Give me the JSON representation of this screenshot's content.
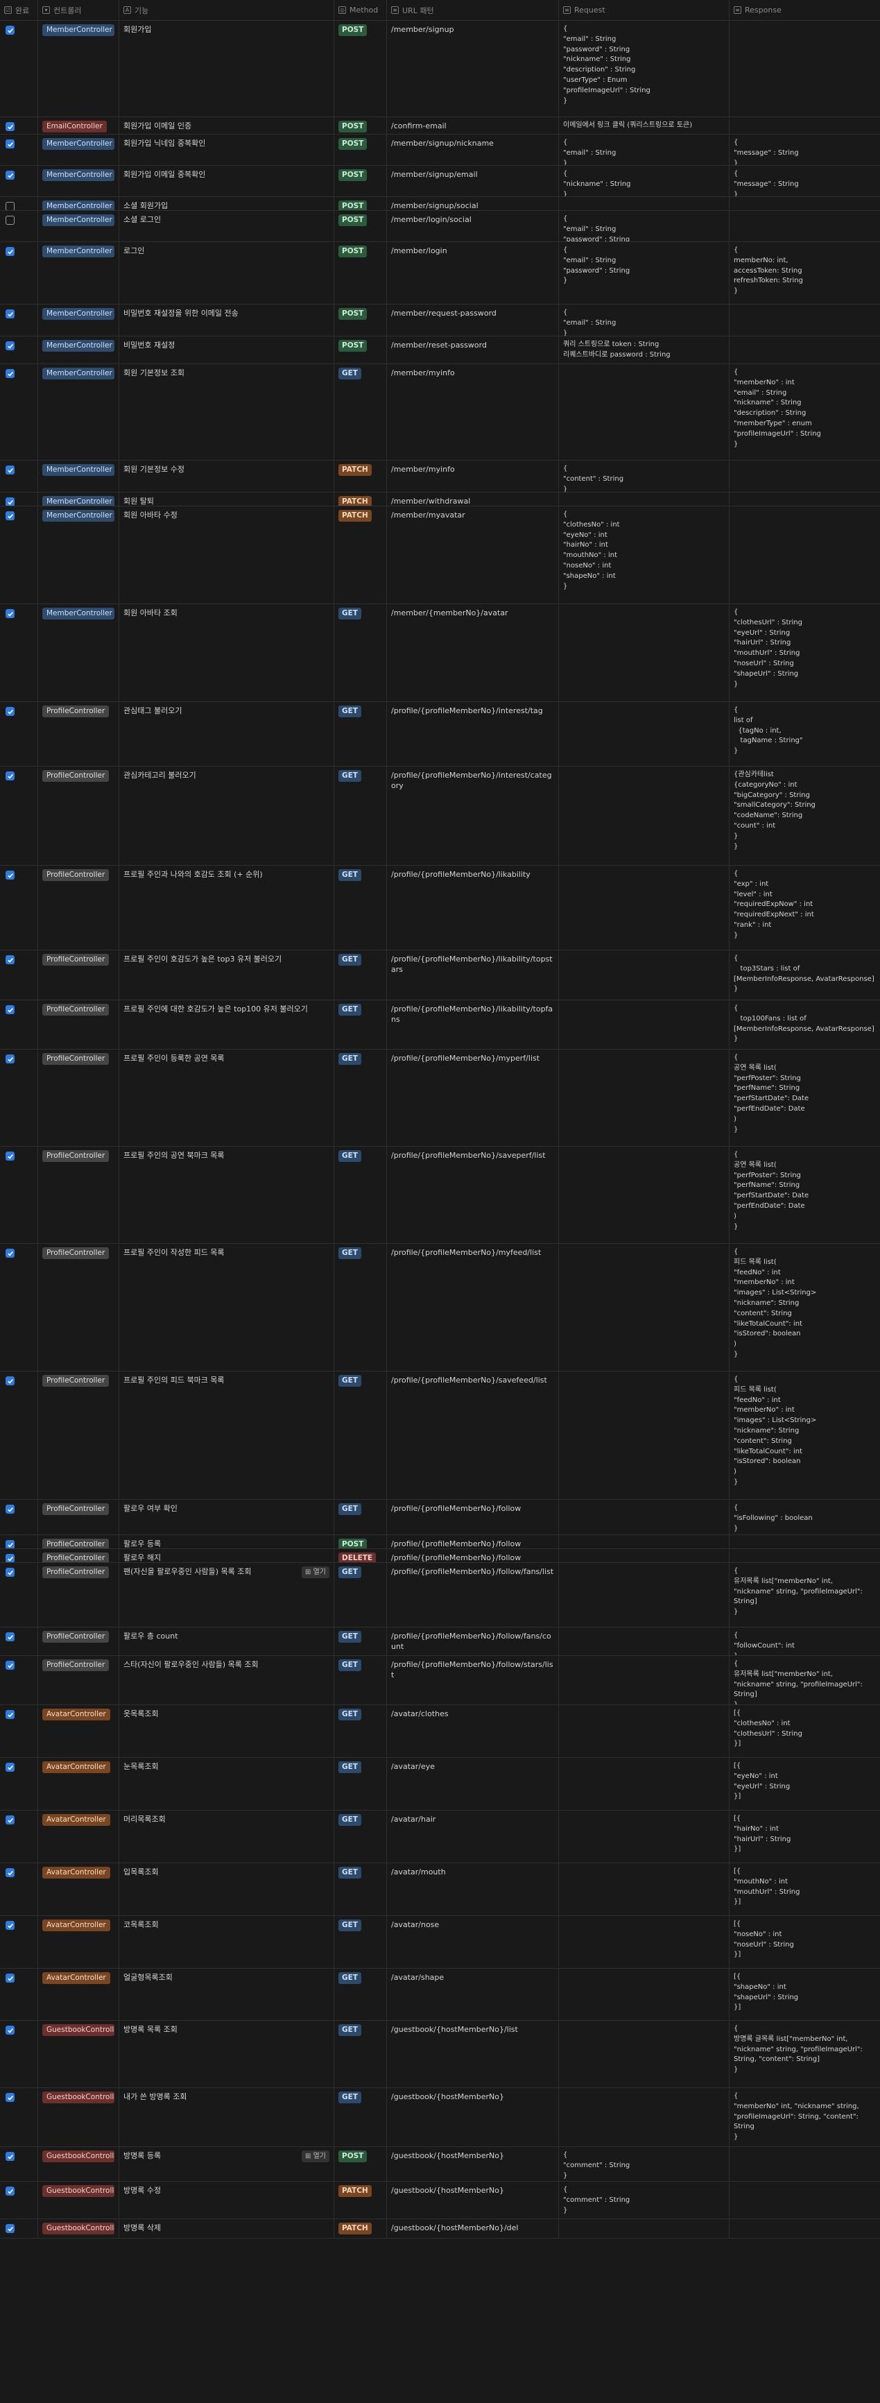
{
  "headers": {
    "done": "완료",
    "controller": "컨트롤러",
    "function": "기능",
    "method": "Method",
    "url": "URL 패턴",
    "request": "Request",
    "response": "Response"
  },
  "open_label": "열기",
  "rows": [
    {
      "done": true,
      "ctrl": "MemberController",
      "ct": "member",
      "func": "회원가입",
      "method": "POST",
      "url": "/member/signup",
      "req": "{\n\"email\" : String\n\"password\" : String\n\"nickname\" : String\n\"description\" : String\n\"userType\" : Enum\n\"profileImageUrl\" : String\n}",
      "res": ""
    },
    {
      "done": true,
      "ctrl": "EmailController",
      "ct": "email",
      "func": "회원가입 이메일 인증",
      "method": "POST",
      "url": "/confirm-email",
      "req": "이메일에서 링크 클릭 (쿼리스트링으로 토큰)",
      "res": ""
    },
    {
      "done": true,
      "ctrl": "MemberController",
      "ct": "member",
      "func": "회원가입 닉네임 중복확인",
      "method": "POST",
      "url": "/member/signup/nickname",
      "req": "{\n\"email\" : String\n}",
      "res": "{\n\"message\" : String\n}"
    },
    {
      "done": true,
      "ctrl": "MemberController",
      "ct": "member",
      "func": "회원가입 이메일 중복확인",
      "method": "POST",
      "url": "/member/signup/email",
      "req": "{\n\"nickname\" : String\n}",
      "res": "{\n\"message\" : String\n}"
    },
    {
      "done": false,
      "ctrl": "MemberController",
      "ct": "member",
      "func": "소셜 회원가입",
      "method": "POST",
      "url": "/member/signup/social",
      "req": "",
      "res": ""
    },
    {
      "done": false,
      "ctrl": "MemberController",
      "ct": "member",
      "func": "소셜 로그인",
      "method": "POST",
      "url": "/member/login/social",
      "req": "{\n\"email\" : String\n\"password\" : String\n}",
      "res": ""
    },
    {
      "done": true,
      "ctrl": "MemberController",
      "ct": "member",
      "func": "로그인",
      "method": "POST",
      "url": "/member/login",
      "req": "{\n\"email\" : String\n\"password\" : String\n}",
      "res": "{\nmemberNo: int,\naccessToken: String\nrefreshToken: String\n}"
    },
    {
      "done": true,
      "ctrl": "MemberController",
      "ct": "member",
      "func": "비밀번호 재설정을 위한 이메일 전송",
      "method": "POST",
      "url": "/member/request-password",
      "req": "{\n\"email\" : String\n}",
      "res": ""
    },
    {
      "done": true,
      "ctrl": "MemberController",
      "ct": "member",
      "func": "비밀번호 재설정",
      "method": "POST",
      "url": "/member/reset-password",
      "req": "쿼리 스트링으로 token : String\n리퀘스트바디로 password : String",
      "res": ""
    },
    {
      "done": true,
      "ctrl": "MemberController",
      "ct": "member",
      "func": "회원 기본정보 조회",
      "method": "GET",
      "url": "/member/myinfo",
      "req": "",
      "res": "{\n\"memberNo\" : int\n\"email\" : String\n\"nickname\" : String\n\"description\" : String\n\"memberType\" : enum\n\"profileImageUrl\" : String\n}"
    },
    {
      "done": true,
      "ctrl": "MemberController",
      "ct": "member",
      "func": "회원 기본정보 수정",
      "method": "PATCH",
      "url": "/member/myinfo",
      "req": "{\n\"content\" : String\n}",
      "res": ""
    },
    {
      "done": true,
      "ctrl": "MemberController",
      "ct": "member",
      "func": "회원 탈퇴",
      "method": "PATCH",
      "url": "/member/withdrawal",
      "req": "",
      "res": ""
    },
    {
      "done": true,
      "ctrl": "MemberController",
      "ct": "member",
      "func": "회원 아바타 수정",
      "method": "PATCH",
      "url": "/member/myavatar",
      "req": "{\n\"clothesNo\" : int\n\"eyeNo\" : int\n\"hairNo\" : int\n\"mouthNo\" : int\n\"noseNo\" : int\n\"shapeNo\" : int\n}",
      "res": ""
    },
    {
      "done": true,
      "ctrl": "MemberController",
      "ct": "member",
      "func": "회원 아바타 조회",
      "method": "GET",
      "url": "/member/{memberNo}/avatar",
      "req": "",
      "res": "{\n\"clothesUrl\" : String\n\"eyeUrl\" : String\n\"hairUrl\" : String\n\"mouthUrl\" : String\n\"noseUrl\" : String\n\"shapeUrl\" : String\n}"
    },
    {
      "done": true,
      "ctrl": "ProfileController",
      "ct": "profile",
      "func": "관심태그 불러오기",
      "method": "GET",
      "url": "/profile/{profileMemberNo}/interest/tag",
      "req": "",
      "res": "{\nlist of\n  {tagNo : int,\n   tagName : String\"\n}"
    },
    {
      "done": true,
      "ctrl": "ProfileController",
      "ct": "profile",
      "func": "관심카테고리 불러오기",
      "method": "GET",
      "url": "/profile/{profileMemberNo}/interest/category",
      "req": "",
      "res": "{관심카테list\n{categoryNo\" : int\n\"bigCategory\" : String\n\"smallCategory\": String\n\"codeName\": String\n\"count\" : int\n}\n}"
    },
    {
      "done": true,
      "ctrl": "ProfileController",
      "ct": "profile",
      "func": "프로필 주인과 나와의 호감도 조회 (+ 순위)",
      "method": "GET",
      "url": "/profile/{profileMemberNo}/likability",
      "req": "",
      "res": "{\n\"exp\" : int\n\"level\" : int\n\"requiredExpNow\" : int\n\"requiredExpNext\" : int\n\"rank\" : int\n}"
    },
    {
      "done": true,
      "ctrl": "ProfileController",
      "ct": "profile",
      "func": "프로필 주인이 호감도가 높은 top3 유저 불러오기",
      "method": "GET",
      "url": "/profile/{profileMemberNo}/likability/topstars",
      "req": "",
      "res": "{\n   top3Stars : list of\n[MemberInfoResponse, AvatarResponse]\n}"
    },
    {
      "done": true,
      "ctrl": "ProfileController",
      "ct": "profile",
      "func": "프로필 주인에 대한 호감도가 높은 top100 유저 불러오기",
      "method": "GET",
      "url": "/profile/{profileMemberNo}/likability/topfans",
      "req": "",
      "res": "{\n   top100Fans : list of\n[MemberInfoResponse, AvatarResponse]\n}"
    },
    {
      "done": true,
      "ctrl": "ProfileController",
      "ct": "profile",
      "func": "프로필 주인이 등록한 공연 목록",
      "method": "GET",
      "url": "/profile/{profileMemberNo}/myperf/list",
      "req": "",
      "res": "{\n공연 목록 list(\n\"perfPoster\": String\n\"perfName\": String\n\"perfStartDate\": Date\n\"perfEndDate\": Date\n)\n}"
    },
    {
      "done": true,
      "ctrl": "ProfileController",
      "ct": "profile",
      "func": "프로필 주인의 공연 북마크 목록",
      "method": "GET",
      "url": "/profile/{profileMemberNo}/saveperf/list",
      "req": "",
      "res": "{\n공연 목록 list(\n\"perfPoster\": String\n\"perfName\": String\n\"perfStartDate\": Date\n\"perfEndDate\": Date\n)\n}"
    },
    {
      "done": true,
      "ctrl": "ProfileController",
      "ct": "profile",
      "func": "프로필 주인이 작성한 피드 목록",
      "method": "GET",
      "url": "/profile/{profileMemberNo}/myfeed/list",
      "req": "",
      "res": "{\n피드 목록 list(\n\"feedNo\" : int\n\"memberNo\" : int\n\"images\" : List<String>\n\"nickname\": String\n\"content\": String\n\"likeTotalCount\": int\n\"isStored\": boolean\n)\n}"
    },
    {
      "done": true,
      "ctrl": "ProfileController",
      "ct": "profile",
      "func": "프로필 주인의 피드 북마크 목록",
      "method": "GET",
      "url": "/profile/{profileMemberNo}/savefeed/list",
      "req": "",
      "res": "{\n피드 목록 list(\n\"feedNo\" : int\n\"memberNo\" : int\n\"images\" : List<String>\n\"nickname\": String\n\"content\": String\n\"likeTotalCount\": int\n\"isStored\": boolean\n)\n}"
    },
    {
      "done": true,
      "ctrl": "ProfileController",
      "ct": "profile",
      "func": "팔로우 여부 확인",
      "method": "GET",
      "url": "/profile/{profileMemberNo}/follow",
      "req": "",
      "res": "{\n\"isFollowing\" : boolean\n}"
    },
    {
      "done": true,
      "ctrl": "ProfileController",
      "ct": "profile",
      "func": "팔로우 등록",
      "method": "POST",
      "url": "/profile/{profileMemberNo}/follow",
      "req": "",
      "res": ""
    },
    {
      "done": true,
      "ctrl": "ProfileController",
      "ct": "profile",
      "func": "팔로우 해지",
      "method": "DELETE",
      "url": "/profile/{profileMemberNo}/follow",
      "req": "",
      "res": ""
    },
    {
      "done": true,
      "ctrl": "ProfileController",
      "ct": "profile",
      "func": "팬(자신을 팔로우중인 사람들) 목록 조회",
      "open": true,
      "method": "GET",
      "url": "/profile/{profileMemberNo}/follow/fans/list",
      "req": "",
      "res": "{\n유저목록 list[\"memberNo\" int,\n\"nickname\" string, \"profileImageUrl\":\nString]\n}"
    },
    {
      "done": true,
      "ctrl": "ProfileController",
      "ct": "profile",
      "func": "팔로우 총 count",
      "method": "GET",
      "url": "/profile/{profileMemberNo}/follow/fans/count",
      "req": "",
      "res": "{\n\"followCount\": int\n}"
    },
    {
      "done": true,
      "ctrl": "ProfileController",
      "ct": "profile",
      "func": "스타(자신이 팔로우중인 사람들) 목록 조회",
      "method": "GET",
      "url": "/profile/{profileMemberNo}/follow/stars/list",
      "req": "",
      "res": "{\n유저목록 list[\"memberNo\" int,\n\"nickname\" string, \"profileImageUrl\":\nString]\n}"
    },
    {
      "done": true,
      "ctrl": "AvatarController",
      "ct": "avatar",
      "func": "옷목록조회",
      "method": "GET",
      "url": "/avatar/clothes",
      "req": "",
      "res": "[{\n\"clothesNo\" : int\n\"clothesUrl\" : String\n}]"
    },
    {
      "done": true,
      "ctrl": "AvatarController",
      "ct": "avatar",
      "func": "눈목록조회",
      "method": "GET",
      "url": "/avatar/eye",
      "req": "",
      "res": "[{\n\"eyeNo\" : int\n\"eyeUrl\" : String\n}]"
    },
    {
      "done": true,
      "ctrl": "AvatarController",
      "ct": "avatar",
      "func": "머리목록조회",
      "method": "GET",
      "url": "/avatar/hair",
      "req": "",
      "res": "[{\n\"hairNo\" : int\n\"hairUrl\" : String\n}]"
    },
    {
      "done": true,
      "ctrl": "AvatarController",
      "ct": "avatar",
      "func": "입목록조회",
      "method": "GET",
      "url": "/avatar/mouth",
      "req": "",
      "res": "[{\n\"mouthNo\" : int\n\"mouthUrl\" : String\n}]"
    },
    {
      "done": true,
      "ctrl": "AvatarController",
      "ct": "avatar",
      "func": "코목록조회",
      "method": "GET",
      "url": "/avatar/nose",
      "req": "",
      "res": "[{\n\"noseNo\" : int\n\"noseUrl\" : String\n}]"
    },
    {
      "done": true,
      "ctrl": "AvatarController",
      "ct": "avatar",
      "func": "얼굴형목록조회",
      "method": "GET",
      "url": "/avatar/shape",
      "req": "",
      "res": "[{\n\"shapeNo\" : int\n\"shapeUrl\" : String\n}]"
    },
    {
      "done": true,
      "ctrl": "GuestbookController",
      "ct": "guest",
      "func": "방명록 목록 조회",
      "method": "GET",
      "url": "/guestbook/{hostMemberNo}/list",
      "req": "",
      "res": "{\n방명록 글목록 list[\"memberNo\" int,\n\"nickname\" string, \"profileImageUrl\":\nString, \"content\": String]\n}"
    },
    {
      "done": true,
      "ctrl": "GuestbookController",
      "ct": "guest",
      "func": "내가 쓴 방명록 조회",
      "method": "GET",
      "url": "/guestbook/{hostMemberNo}",
      "req": "",
      "res": "{\n\"memberNo\" int, \"nickname\" string,\n\"profileImageUrl\": String, \"content\":\nString\n}"
    },
    {
      "done": true,
      "ctrl": "GuestbookController",
      "ct": "guest",
      "func": "방명록 등록",
      "open": true,
      "method": "POST",
      "url": "/guestbook/{hostMemberNo}",
      "req": "{\n\"comment\" : String\n}",
      "res": ""
    },
    {
      "done": true,
      "ctrl": "GuestbookController",
      "ct": "guest",
      "func": "방명록 수정",
      "method": "PATCH",
      "url": "/guestbook/{hostMemberNo}",
      "req": "{\n\"comment\" : String\n}",
      "res": ""
    },
    {
      "done": true,
      "ctrl": "GuestbookController",
      "ct": "guest",
      "func": "방명록 삭제",
      "method": "PATCH",
      "url": "/guestbook/{hostMemberNo}/del",
      "req": "",
      "res": ""
    }
  ]
}
